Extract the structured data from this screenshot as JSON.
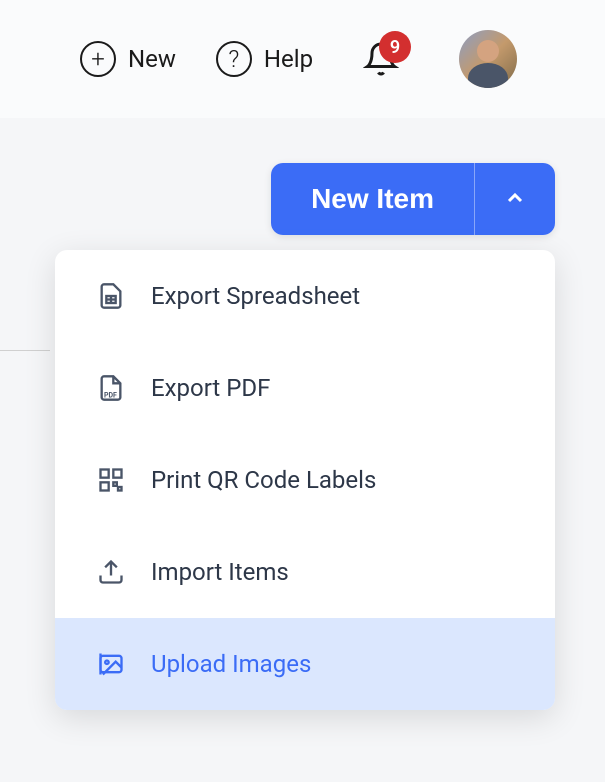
{
  "header": {
    "new_label": "New",
    "help_label": "Help",
    "notification_count": "9"
  },
  "button": {
    "main_label": "New Item"
  },
  "menu": {
    "items": [
      {
        "label": "Export Spreadsheet",
        "icon": "spreadsheet-icon",
        "highlighted": false
      },
      {
        "label": "Export PDF",
        "icon": "pdf-icon",
        "highlighted": false
      },
      {
        "label": "Print QR Code Labels",
        "icon": "qr-icon",
        "highlighted": false
      },
      {
        "label": "Import Items",
        "icon": "import-icon",
        "highlighted": false
      },
      {
        "label": "Upload Images",
        "icon": "image-icon",
        "highlighted": true
      }
    ]
  }
}
